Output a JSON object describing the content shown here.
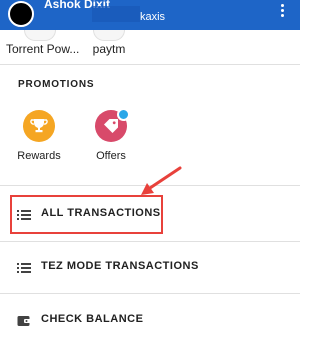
{
  "appbar": {
    "title": "Ashok Dixit",
    "subtitle": "kaxis",
    "bg_color": "#1e65c7"
  },
  "recents": [
    {
      "label": "Torrent Pow..."
    },
    {
      "label": "paytm"
    }
  ],
  "promotions": {
    "title": "PROMOTIONS",
    "items": [
      {
        "label": "Rewards",
        "icon": "trophy-icon",
        "color": "#f5a623"
      },
      {
        "label": "Offers",
        "icon": "tag-icon",
        "color": "#d84a6a"
      }
    ]
  },
  "menu": [
    {
      "label": "ALL TRANSACTIONS",
      "icon": "list-icon"
    },
    {
      "label": "TEZ MODE TRANSACTIONS",
      "icon": "list-icon"
    },
    {
      "label": "CHECK BALANCE",
      "icon": "wallet-icon"
    }
  ],
  "annotation": {
    "color": "#e8413b",
    "target": "ALL TRANSACTIONS"
  }
}
